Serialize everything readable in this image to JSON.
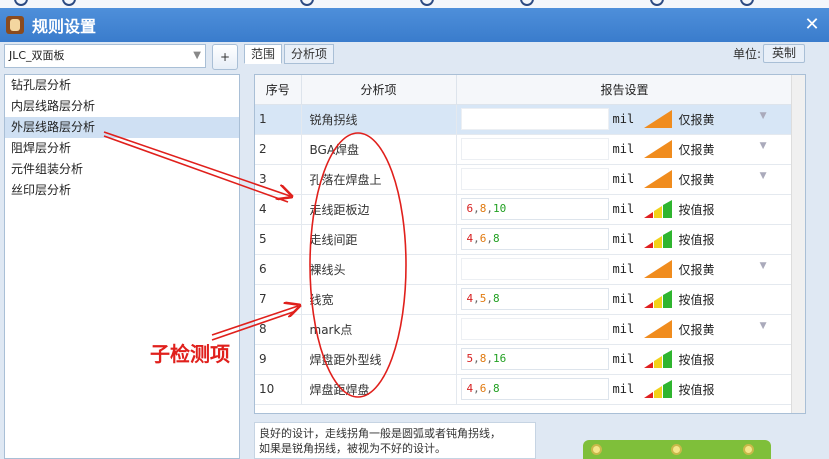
{
  "window": {
    "title": "规则设置",
    "close_label": "✕"
  },
  "left": {
    "combo_value": "JLC_双面板",
    "add_label": "+",
    "categories": [
      "钻孔层分析",
      "内层线路层分析",
      "外层线路层分析",
      "阻焊层分析",
      "元件组装分析",
      "丝印层分析"
    ]
  },
  "right": {
    "tabs": [
      "范围",
      "分析项"
    ],
    "unit_label": "单位:",
    "unit_value": "英制",
    "headers": {
      "num": "序号",
      "item": "分析项",
      "report": "报告设置"
    },
    "rows": [
      {
        "num": "1",
        "name": "锐角拐线",
        "values": [],
        "unit": "mil",
        "severity": "orange",
        "mode": "仅报黄",
        "dropdown": true
      },
      {
        "num": "2",
        "name": "BGA焊盘",
        "values": [],
        "unit": "mil",
        "severity": "orange",
        "mode": "仅报黄",
        "dropdown": true
      },
      {
        "num": "3",
        "name": "孔落在焊盘上",
        "values": [],
        "unit": "mil",
        "severity": "orange",
        "mode": "仅报黄",
        "dropdown": true
      },
      {
        "num": "4",
        "name": "走线距板边",
        "values": [
          "6",
          "8",
          "10"
        ],
        "unit": "mil",
        "severity": "tri",
        "mode": "按值报",
        "dropdown": false
      },
      {
        "num": "5",
        "name": "走线间距",
        "values": [
          "4",
          "6",
          "8"
        ],
        "unit": "mil",
        "severity": "tri",
        "mode": "按值报",
        "dropdown": false
      },
      {
        "num": "6",
        "name": "裸线头",
        "values": [],
        "unit": "mil",
        "severity": "orange",
        "mode": "仅报黄",
        "dropdown": true
      },
      {
        "num": "7",
        "name": "线宽",
        "values": [
          "4",
          "5",
          "8"
        ],
        "unit": "mil",
        "severity": "tri",
        "mode": "按值报",
        "dropdown": false
      },
      {
        "num": "8",
        "name": "mark点",
        "values": [],
        "unit": "mil",
        "severity": "orange",
        "mode": "仅报黄",
        "dropdown": true
      },
      {
        "num": "9",
        "name": "焊盘距外型线",
        "values": [
          "5",
          "8",
          "16"
        ],
        "unit": "mil",
        "severity": "tri",
        "mode": "按值报",
        "dropdown": false
      },
      {
        "num": "10",
        "name": "焊盘距焊盘",
        "values": [
          "4",
          "6",
          "8"
        ],
        "unit": "mil",
        "severity": "tri",
        "mode": "按值报",
        "dropdown": false
      }
    ],
    "description_lines": [
      "良好的设计，走线拐角一般是圆弧或者钝角拐线，",
      "如果是锐角拐线，被视为不好的设计。"
    ]
  },
  "annotation": {
    "label": "子检测项",
    "color": "#e0201c"
  },
  "colors": {
    "orange": "#f08c1e",
    "red": "#e02020",
    "yellow": "#f2d21a",
    "green": "#2fb52f",
    "titlebar": "#3a7ccc"
  }
}
